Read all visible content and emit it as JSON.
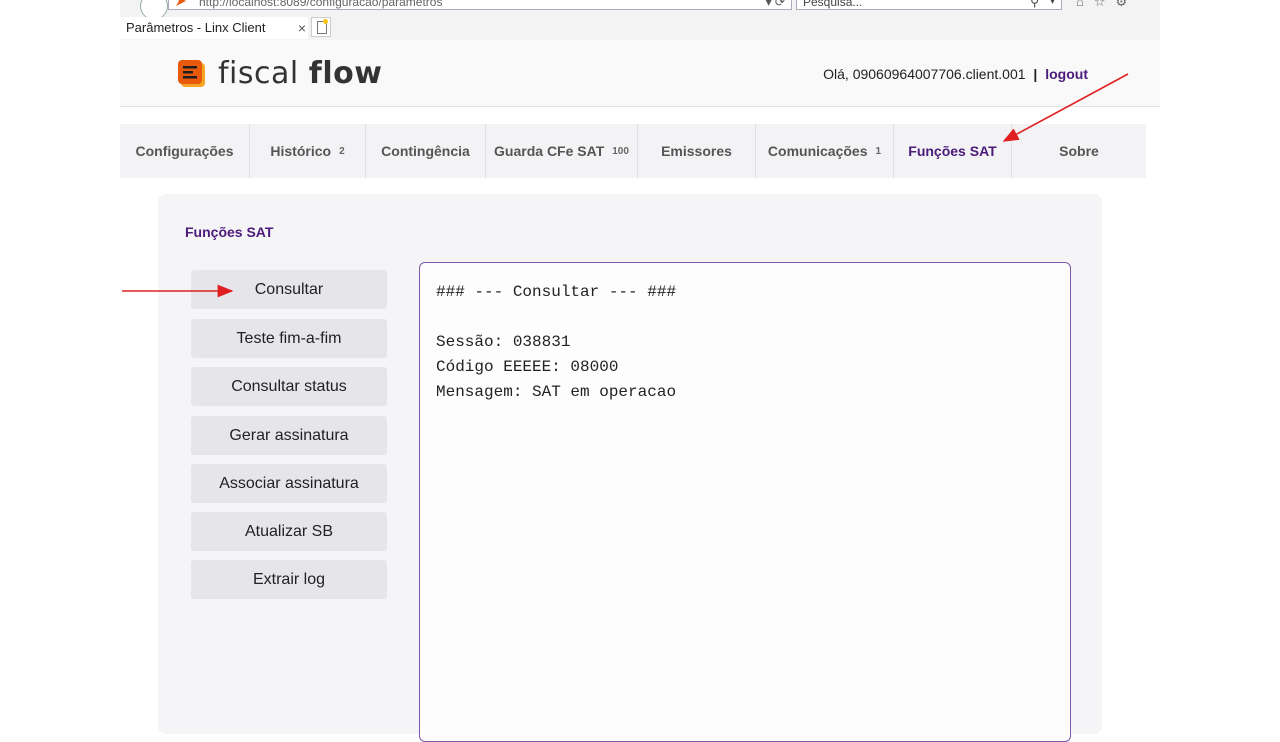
{
  "browser": {
    "address": "http://localhost:8089/configuracao/parametros",
    "search_placeholder": "Pesquisa...",
    "tab_title": "Parâmetros - Linx Client",
    "tab_close": "×"
  },
  "header": {
    "logo_light": "fiscal",
    "logo_bold": "flow",
    "greeting": "Olá, 09060964007706.client.001",
    "separator": "|",
    "logout": "logout"
  },
  "nav": {
    "items": [
      {
        "label": "Configurações",
        "count": ""
      },
      {
        "label": "Histórico",
        "count": "2"
      },
      {
        "label": "Contingência",
        "count": ""
      },
      {
        "label": "Guarda CFe SAT",
        "count": "100"
      },
      {
        "label": "Emissores",
        "count": ""
      },
      {
        "label": "Comunicações",
        "count": "1"
      },
      {
        "label": "Funções SAT",
        "count": ""
      },
      {
        "label": "Sobre",
        "count": ""
      }
    ]
  },
  "panel": {
    "title": "Funções SAT",
    "buttons": [
      "Consultar",
      "Teste fim-a-fim",
      "Consultar status",
      "Gerar assinatura",
      "Associar assinatura",
      "Atualizar SB",
      "Extrair log"
    ],
    "output": "### --- Consultar --- ###\n\nSessão: 038831\nCódigo EEEEE: 08000\nMensagem: SAT em operacao"
  },
  "colors": {
    "accent": "#4b1a7a",
    "annotation": "#e02020"
  }
}
